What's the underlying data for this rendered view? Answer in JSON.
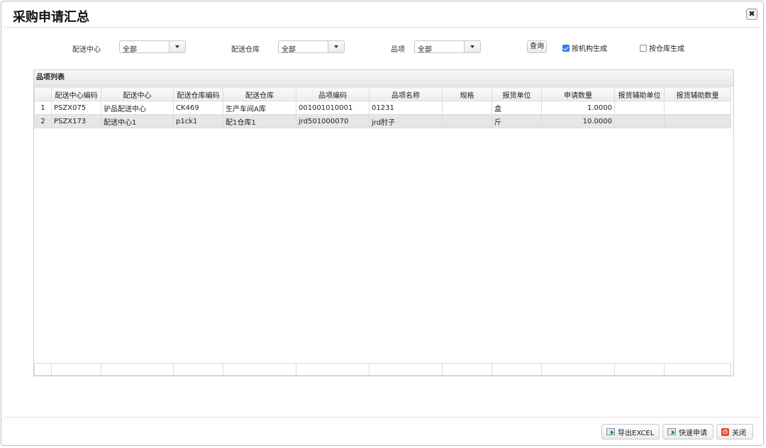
{
  "window": {
    "title": "采购申请汇总"
  },
  "filters": {
    "center_label": "配送中心",
    "center_value": "全部",
    "warehouse_label": "配送仓库",
    "warehouse_value": "全部",
    "item_label": "品项",
    "item_value": "全部",
    "query_label": "查询",
    "by_org_label": "按机构生成",
    "by_org_checked": true,
    "by_wh_label": "按仓库生成",
    "by_wh_checked": false
  },
  "panel": {
    "title": "品项列表"
  },
  "table": {
    "columns": [
      "配送中心编码",
      "配送中心",
      "配送仓库编码",
      "配送仓库",
      "品项编码",
      "品项名称",
      "规格",
      "报货单位",
      "申请数量",
      "报货辅助单位",
      "报货辅助数量"
    ],
    "rows": [
      {
        "idx": "1",
        "center_code": "PSZX075",
        "center": "驴品配送中心",
        "wh_code": "CK469",
        "wh": "生产车间A库",
        "item_code": "001001010001",
        "item_name": "01231",
        "spec": "",
        "unit": "盒",
        "qty": "1.0000",
        "aux_unit": "",
        "aux_qty": ""
      },
      {
        "idx": "2",
        "center_code": "PSZX173",
        "center": "配送中心1",
        "wh_code": "p1ck1",
        "wh": "配1仓库1",
        "item_code": "jrd501000070",
        "item_name": "jrd肘子",
        "spec": "",
        "unit": "斤",
        "qty": "10.0000",
        "aux_unit": "",
        "aux_qty": ""
      }
    ]
  },
  "footer": {
    "export_label": "导出EXCEL",
    "quick_label": "快速申请",
    "close_label": "关闭"
  },
  "colors": {
    "accent": "#2b7de9",
    "close_icon": "#e04a2f",
    "row_alt": "#e6e6e6"
  }
}
